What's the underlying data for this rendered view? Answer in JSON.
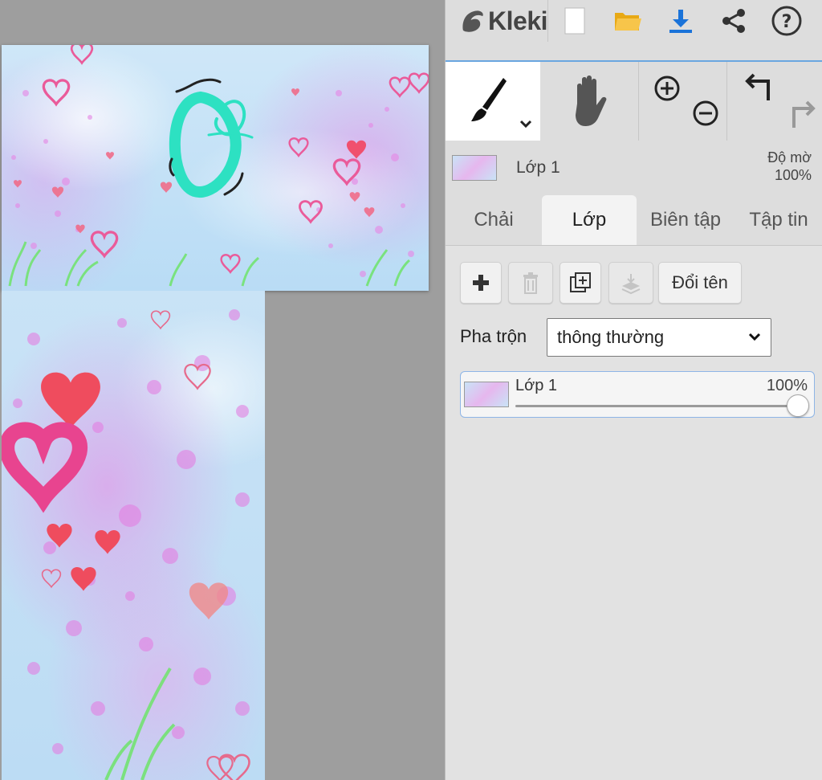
{
  "app": {
    "logo_text": "Kleki"
  },
  "toolbar": {
    "icons": [
      "new-file-icon",
      "open-folder-icon",
      "download-icon",
      "share-icon",
      "help-icon"
    ],
    "help_glyph": "?"
  },
  "colors": {
    "accent": "#1a73d9",
    "folder": "#f2b31c",
    "heart": "#f0506e",
    "stroke": "#2de1c2"
  },
  "layer_strip": {
    "name": "Lớp 1",
    "opacity_label": "Độ mờ",
    "opacity_value": "100%"
  },
  "tabs": [
    {
      "label": "Chải",
      "active": false
    },
    {
      "label": "Lớp",
      "active": true
    },
    {
      "label": "Biên tập",
      "active": false
    },
    {
      "label": "Tập tin",
      "active": false
    }
  ],
  "layers_panel": {
    "add_icon": "plus-icon",
    "delete_icon": "trash-icon",
    "duplicate_icon": "duplicate-icon",
    "merge_icon": "merge-down-icon",
    "rename_label": "Đổi tên",
    "blend_label": "Pha trộn",
    "blend_value": "thông thường",
    "layers": [
      {
        "name": "Lớp 1",
        "opacity": "100%",
        "opacity_fraction": 1.0
      }
    ]
  }
}
